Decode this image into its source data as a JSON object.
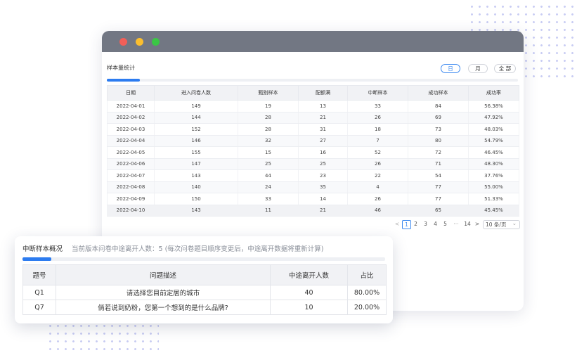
{
  "window": {
    "section_title": "样本量统计",
    "tabs": [
      {
        "label": "日",
        "active": true
      },
      {
        "label": "月",
        "active": false
      },
      {
        "label": "全 部",
        "active": false
      }
    ],
    "progress_fraction": 0.08,
    "table": {
      "columns": [
        "日期",
        "进入问卷人数",
        "甄别样本",
        "配额满",
        "中断样本",
        "成功样本",
        "成功率"
      ],
      "rows": [
        [
          "2022-04-01",
          "149",
          "19",
          "13",
          "33",
          "84",
          "56.38%"
        ],
        [
          "2022-04-02",
          "144",
          "28",
          "21",
          "26",
          "69",
          "47.92%"
        ],
        [
          "2022-04-03",
          "152",
          "28",
          "31",
          "18",
          "73",
          "48.03%"
        ],
        [
          "2022-04-04",
          "146",
          "32",
          "27",
          "7",
          "80",
          "54.79%"
        ],
        [
          "2022-04-05",
          "155",
          "15",
          "16",
          "52",
          "72",
          "46.45%"
        ],
        [
          "2022-04-06",
          "147",
          "25",
          "25",
          "26",
          "71",
          "48.30%"
        ],
        [
          "2022-04-07",
          "143",
          "44",
          "23",
          "22",
          "54",
          "37.76%"
        ],
        [
          "2022-04-08",
          "140",
          "24",
          "35",
          "4",
          "77",
          "55.00%"
        ],
        [
          "2022-04-09",
          "150",
          "33",
          "14",
          "26",
          "77",
          "51.33%"
        ],
        [
          "2022-04-10",
          "143",
          "11",
          "21",
          "46",
          "65",
          "45.45%"
        ]
      ]
    },
    "pagination": {
      "prev": "<",
      "pages": [
        "1",
        "2",
        "3",
        "4",
        "5"
      ],
      "active_page": "1",
      "ellipsis": "···",
      "last_page": "14",
      "next": ">",
      "page_size": "10 条/页",
      "chevron": "⌄"
    }
  },
  "card": {
    "title": "中断样本概况",
    "subtitle": "当前版本问卷中途离开人数：5 (每次问卷题目顺序变更后，中途离开数据将重新计算)",
    "progress_fraction": 0.08,
    "table": {
      "columns": [
        "题号",
        "问题描述",
        "中途离开人数",
        "占比"
      ],
      "rows": [
        [
          "Q1",
          "请选择您目前定居的城市",
          "40",
          "80.00%"
        ],
        [
          "Q7",
          "倘若说到奶粉，您第一个想到的是什么品牌?",
          "10",
          "20.00%"
        ]
      ]
    }
  },
  "colors": {
    "accent": "#2d7cf0",
    "titlebar": "#727783",
    "traffic_red": "#f25f58",
    "traffic_yellow": "#fbbe2e",
    "traffic_green": "#3bc745",
    "dots": "#c9cdf3"
  }
}
